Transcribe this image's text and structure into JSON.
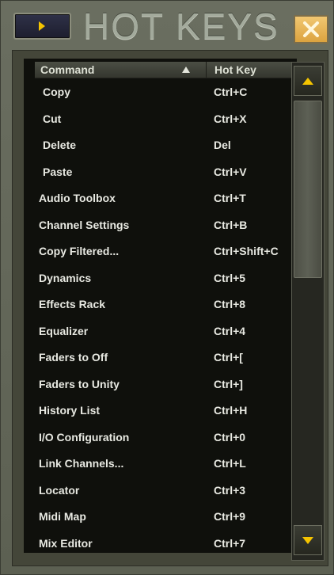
{
  "window": {
    "title": "HOT KEYS",
    "expand_icon": "right-arrow-icon",
    "close_icon": "close-x-icon"
  },
  "columns": {
    "command": "Command",
    "hotkey": "Hot Key",
    "sort": "ascending"
  },
  "rows": [
    {
      "command": "Copy",
      "hotkey": "Ctrl+C",
      "indent": true
    },
    {
      "command": "Cut",
      "hotkey": "Ctrl+X",
      "indent": true
    },
    {
      "command": "Delete",
      "hotkey": "Del",
      "indent": true
    },
    {
      "command": "Paste",
      "hotkey": "Ctrl+V",
      "indent": true
    },
    {
      "command": "Audio Toolbox",
      "hotkey": "Ctrl+T",
      "indent": false
    },
    {
      "command": "Channel Settings",
      "hotkey": "Ctrl+B",
      "indent": false
    },
    {
      "command": "Copy Filtered...",
      "hotkey": "Ctrl+Shift+C",
      "indent": false
    },
    {
      "command": "Dynamics",
      "hotkey": "Ctrl+5",
      "indent": false
    },
    {
      "command": "Effects Rack",
      "hotkey": "Ctrl+8",
      "indent": false
    },
    {
      "command": "Equalizer",
      "hotkey": "Ctrl+4",
      "indent": false
    },
    {
      "command": "Faders to Off",
      "hotkey": "Ctrl+[",
      "indent": false
    },
    {
      "command": "Faders to Unity",
      "hotkey": "Ctrl+]",
      "indent": false
    },
    {
      "command": "History List",
      "hotkey": "Ctrl+H",
      "indent": false
    },
    {
      "command": "I/O Configuration",
      "hotkey": "Ctrl+0",
      "indent": false
    },
    {
      "command": "Link Channels...",
      "hotkey": "Ctrl+L",
      "indent": false
    },
    {
      "command": "Locator",
      "hotkey": "Ctrl+3",
      "indent": false
    },
    {
      "command": "Midi Map",
      "hotkey": "Ctrl+9",
      "indent": false
    },
    {
      "command": "Mix Editor",
      "hotkey": "Ctrl+7",
      "indent": false
    }
  ],
  "scrollbar": {
    "up_icon": "up-arrow-icon",
    "down_icon": "down-arrow-icon",
    "position": 0.0
  },
  "colors": {
    "accent": "#f5c400",
    "list_bg": "#0f100c",
    "text": "#e8e9e2",
    "close_bg": "#e8b45a"
  }
}
